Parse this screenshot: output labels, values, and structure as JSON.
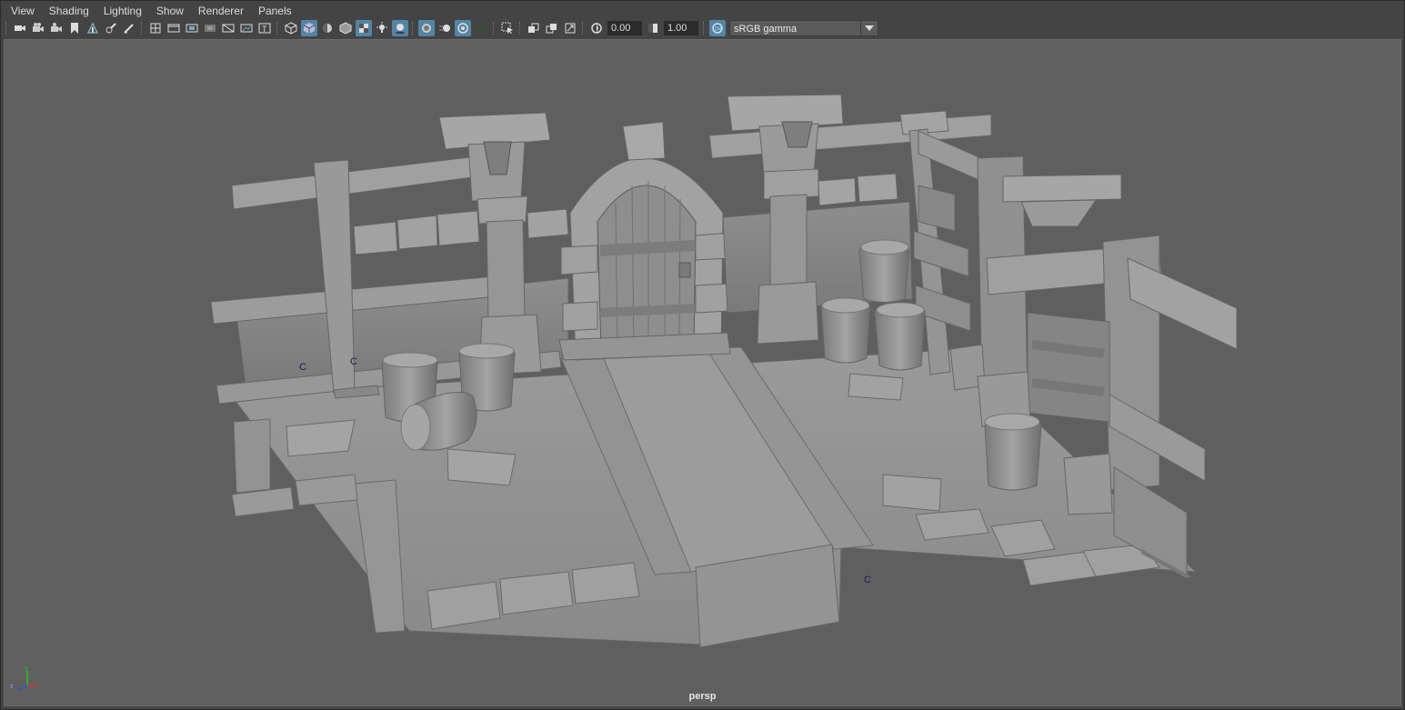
{
  "menubar": {
    "items": [
      "View",
      "Shading",
      "Lighting",
      "Show",
      "Renderer",
      "Panels"
    ]
  },
  "toolbar": {
    "exposure_value": "0.00",
    "gamma_value": "1.00",
    "color_space": "sRGB gamma",
    "icons": [
      "select-camera-icon",
      "camera-attributes-icon",
      "camera-bookmark-icon",
      "image-plane-icon",
      "2d-pan-zoom-icon",
      "grease-pencil-icon",
      "grid-icon",
      "film-gate-icon",
      "resolution-gate-icon",
      "gate-mask-icon",
      "field-chart-icon",
      "safe-action-icon",
      "safe-title-icon",
      "wireframe-icon",
      "smooth-shade-icon",
      "default-material-icon",
      "wireframe-on-shaded-icon",
      "xray-icon",
      "use-all-lights-icon",
      "shadows-icon",
      "screen-space-ao-icon",
      "motion-blur-icon",
      "multisample-aa-icon",
      "depth-of-field-icon",
      "isolate-select-icon",
      "xray-joints-icon",
      "xray-active-icon",
      "backface-icon",
      "exposure-icon",
      "gamma-icon",
      "color-management-icon"
    ]
  },
  "viewport": {
    "camera": "persp",
    "markers": [
      "C",
      "C",
      "C"
    ],
    "colors": {
      "background": "#5f5f5f",
      "geometry": "#8d8d8d",
      "highlight": "#5285a6"
    }
  }
}
